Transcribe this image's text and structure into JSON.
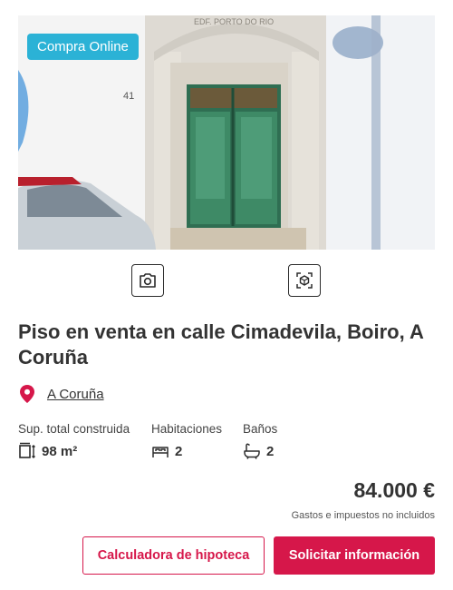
{
  "listing": {
    "badge": "Compra Online",
    "title": "Piso en venta en calle Cimadevila, Boiro, A Coruña",
    "location": "A Coruña",
    "accent_color": "#d6174a",
    "badge_color": "#2bb2d6"
  },
  "photo": {
    "building_sign": "EDF. PORTO DO RIO",
    "house_number": "41"
  },
  "media_buttons": [
    {
      "icon": "camera-icon"
    },
    {
      "icon": "virtual-tour-icon"
    }
  ],
  "features": [
    {
      "label": "Sup. total construida",
      "value": "98 m²",
      "icon": "area-icon"
    },
    {
      "label": "Habitaciones",
      "value": "2",
      "icon": "bed-icon"
    },
    {
      "label": "Baños",
      "value": "2",
      "icon": "bath-icon"
    }
  ],
  "price": {
    "amount": "84.000 €",
    "note": "Gastos e impuestos no incluidos"
  },
  "actions": {
    "mortgage": "Calculadora de hipoteca",
    "request": "Solicitar información"
  }
}
